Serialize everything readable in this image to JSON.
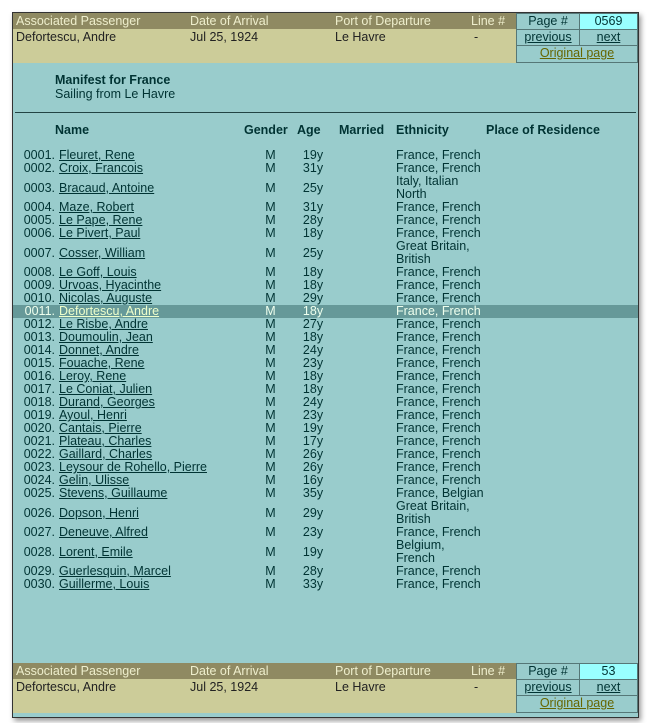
{
  "header": {
    "labels": {
      "passenger": "Associated Passenger",
      "date": "Date of Arrival",
      "port": "Port of Departure",
      "line": "Line #",
      "page": "Page #"
    },
    "passenger": "Defortescu, Andre",
    "date": "Jul 25, 1924",
    "port": "Le Havre",
    "line": "-",
    "page_number": "0569",
    "previous": "previous",
    "next": "next",
    "original": "Original page"
  },
  "footer": {
    "page_number": "53"
  },
  "manifest": {
    "title": "Manifest for France",
    "subtitle": "Sailing from Le Havre"
  },
  "columns": [
    "Name",
    "Gender",
    "Age",
    "Married",
    "Ethnicity",
    "Place of Residence"
  ],
  "highlight_row": "0011",
  "rows": [
    [
      "0001.",
      "Fleuret, Rene",
      "M",
      "19y",
      "",
      "France, French",
      ""
    ],
    [
      "0002.",
      "Croix, Francois",
      "M",
      "31y",
      "",
      "France, French",
      ""
    ],
    [
      "0003.",
      "Bracaud, Antoine",
      "M",
      "25y",
      "",
      "Italy, Italian North",
      ""
    ],
    [
      "0004.",
      "Maze, Robert",
      "M",
      "31y",
      "",
      "France, French",
      ""
    ],
    [
      "0005.",
      "Le Pape, Rene",
      "M",
      "28y",
      "",
      "France, French",
      ""
    ],
    [
      "0006.",
      "Le Pivert, Paul",
      "M",
      "18y",
      "",
      "France, French",
      ""
    ],
    [
      "0007.",
      "Cosser, William",
      "M",
      "25y",
      "",
      "Great Britain, British",
      ""
    ],
    [
      "0008.",
      "Le Goff, Louis",
      "M",
      "18y",
      "",
      "France, French",
      ""
    ],
    [
      "0009.",
      "Urvoas, Hyacinthe",
      "M",
      "18y",
      "",
      "France, French",
      ""
    ],
    [
      "0010.",
      "Nicolas, Auguste",
      "M",
      "29y",
      "",
      "France, French",
      ""
    ],
    [
      "0011.",
      "Defortescu, Andre",
      "M",
      "18y",
      "",
      "France, French",
      ""
    ],
    [
      "0012.",
      "Le Risbe, Andre",
      "M",
      "27y",
      "",
      "France, French",
      ""
    ],
    [
      "0013.",
      "Doumoulin, Jean",
      "M",
      "18y",
      "",
      "France, French",
      ""
    ],
    [
      "0014.",
      "Donnet, Andre",
      "M",
      "24y",
      "",
      "France, French",
      ""
    ],
    [
      "0015.",
      "Fouache, Rene",
      "M",
      "23y",
      "",
      "France, French",
      ""
    ],
    [
      "0016.",
      "Leroy, Rene",
      "M",
      "18y",
      "",
      "France, French",
      ""
    ],
    [
      "0017.",
      "Le Coniat, Julien",
      "M",
      "18y",
      "",
      "France, French",
      ""
    ],
    [
      "0018.",
      "Durand, Georges",
      "M",
      "24y",
      "",
      "France, French",
      ""
    ],
    [
      "0019.",
      "Ayoul, Henri",
      "M",
      "23y",
      "",
      "France, French",
      ""
    ],
    [
      "0020.",
      "Cantais, Pierre",
      "M",
      "19y",
      "",
      "France, French",
      ""
    ],
    [
      "0021.",
      "Plateau, Charles",
      "M",
      "17y",
      "",
      "France, French",
      ""
    ],
    [
      "0022.",
      "Gaillard, Charles",
      "M",
      "26y",
      "",
      "France, French",
      ""
    ],
    [
      "0023.",
      "Leysour de Rohello, Pierre",
      "M",
      "26y",
      "",
      "France, French",
      ""
    ],
    [
      "0024.",
      "Gelin, Ulisse",
      "M",
      "16y",
      "",
      "France, French",
      ""
    ],
    [
      "0025.",
      "Stevens, Guillaume",
      "M",
      "35y",
      "",
      "France, Belgian",
      ""
    ],
    [
      "0026.",
      "Dopson, Henri",
      "M",
      "29y",
      "",
      "Great Britain, British",
      ""
    ],
    [
      "0027.",
      "Deneuve, Alfred",
      "M",
      "23y",
      "",
      "France, French",
      ""
    ],
    [
      "0028.",
      "Lorent, Emile",
      "M",
      "19y",
      "",
      "Belgium, French",
      ""
    ],
    [
      "0029.",
      "Guerlesquin, Marcel",
      "M",
      "28y",
      "",
      "France, French",
      ""
    ],
    [
      "0030.",
      "Guillerme, Louis",
      "M",
      "33y",
      "",
      "France, French",
      ""
    ]
  ]
}
